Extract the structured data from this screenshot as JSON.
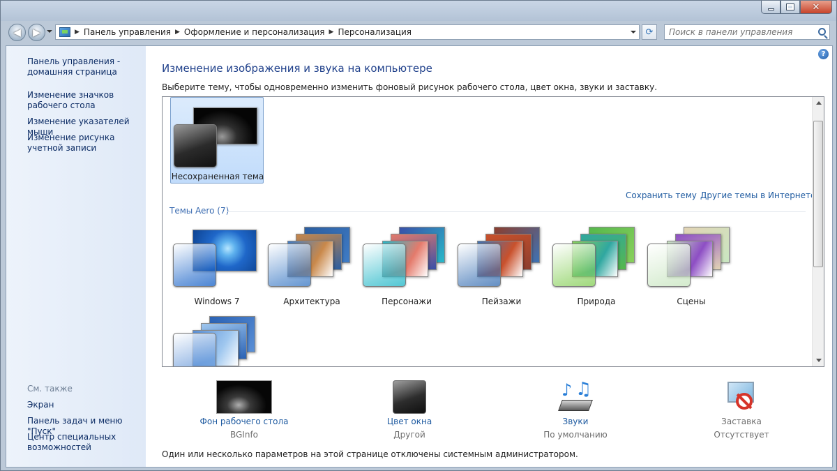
{
  "address": {
    "crumbs": [
      "Панель управления",
      "Оформление и персонализация",
      "Персонализация"
    ]
  },
  "search": {
    "placeholder": "Поиск в панели управления"
  },
  "sidebar": {
    "links": [
      "Панель управления - домашняя страница",
      "Изменение значков рабочего стола",
      "Изменение указателей мыши",
      "Изменение рисунка учетной записи"
    ],
    "see_also_heading": "См. также",
    "see_also": [
      "Экран",
      "Панель задач и меню \"Пуск\"",
      "Центр специальных возможностей"
    ]
  },
  "main": {
    "title": "Изменение изображения и звука на компьютере",
    "subtitle": "Выберите тему, чтобы одновременно изменить фоновый рисунок рабочего стола, цвет окна, звуки и заставку.",
    "unsaved_theme": "Несохраненная тема",
    "save_theme": "Сохранить тему",
    "more_themes": "Другие темы в Интернете",
    "aero_group": "Темы Aero (7)",
    "themes": [
      {
        "label": "Windows 7",
        "colors": [
          "#1f67c9",
          "#5fb2ee",
          "#0b3f8c"
        ]
      },
      {
        "label": "Архитектура",
        "colors": [
          "#3f7cc6",
          "#c9884a",
          "#2c5ea0"
        ]
      },
      {
        "label": "Персонажи",
        "colors": [
          "#28b9c9",
          "#e47a6b",
          "#3a50a8"
        ]
      },
      {
        "label": "Пейзажи",
        "colors": [
          "#3d73b5",
          "#c9512c",
          "#8c3e2e"
        ]
      },
      {
        "label": "Природа",
        "colors": [
          "#89d05c",
          "#2fa7a0",
          "#56b84c"
        ]
      },
      {
        "label": "Сцены",
        "colors": [
          "#c9e6c1",
          "#8d4ec4",
          "#e2d3b4"
        ]
      },
      {
        "label": "",
        "colors": [
          "#5a8fd6",
          "#9fc7ef",
          "#2a62b4"
        ]
      }
    ],
    "footer_note": "Один или несколько параметров на этой странице отключены системным администратором."
  },
  "bottom": [
    {
      "label": "Фон рабочего стола",
      "sub": "BGInfo"
    },
    {
      "label": "Цвет окна",
      "sub": "Другой"
    },
    {
      "label": "Звуки",
      "sub": "По умолчанию"
    },
    {
      "label": "Заставка",
      "sub": "Отсутствует"
    }
  ]
}
